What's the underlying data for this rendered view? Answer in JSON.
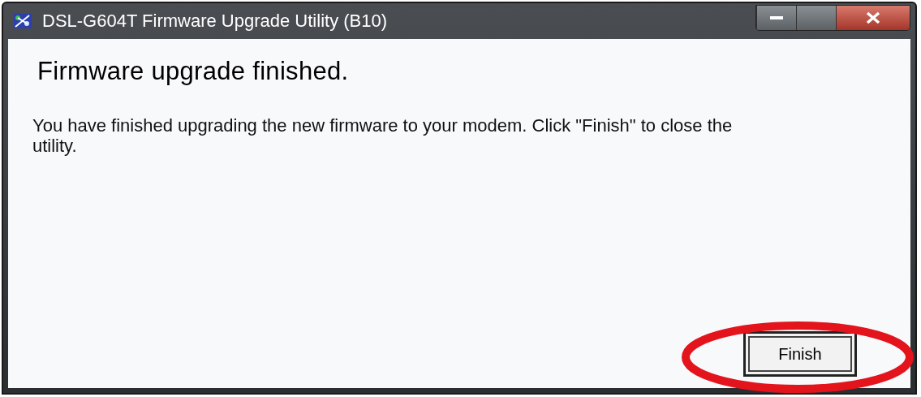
{
  "window": {
    "title": "DSL-G604T Firmware Upgrade Utility (B10)"
  },
  "heading": "Firmware upgrade finished.",
  "message": "You have finished upgrading the new firmware to your modem. Click \"Finish\" to close the utility.",
  "buttons": [
    {
      "label": "Finish",
      "focused": true
    }
  ]
}
